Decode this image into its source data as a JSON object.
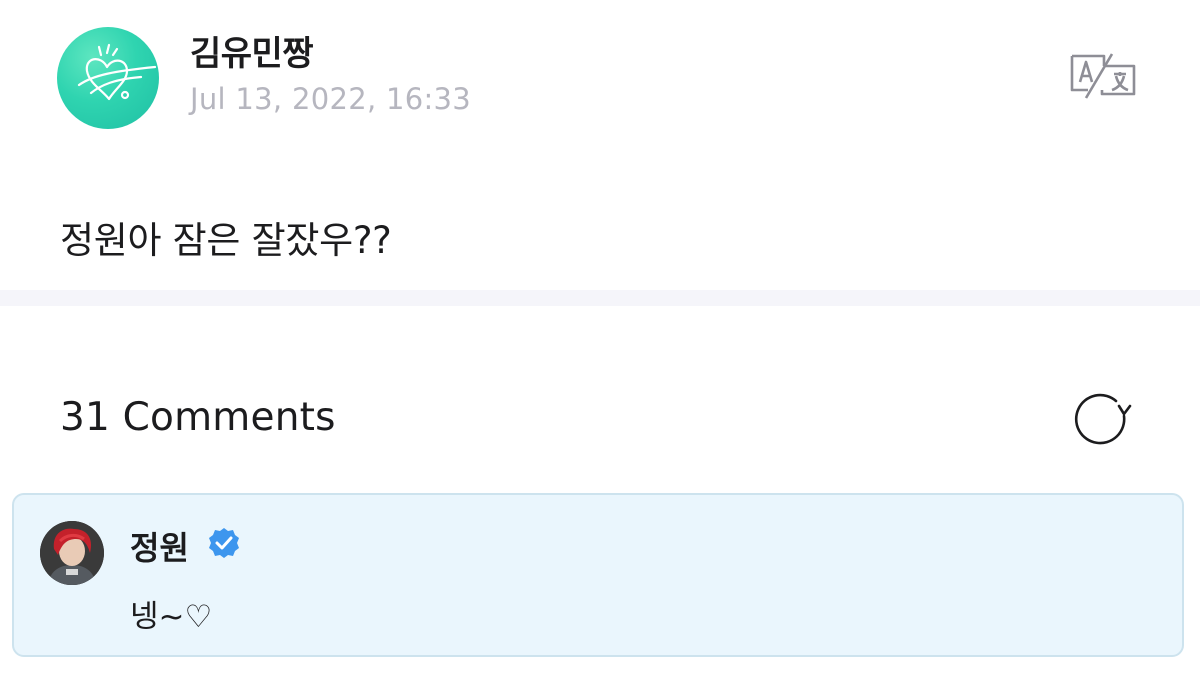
{
  "post": {
    "author_name": "김유민짱",
    "timestamp": "Jul 13, 2022, 16:33",
    "body": "정원아 잠은 잘잤우??",
    "avatar_icon": "signature-heart-avatar",
    "translate_icon": "translate-icon"
  },
  "comments": {
    "header": "31 Comments",
    "refresh_icon": "refresh-icon",
    "items": [
      {
        "author": "정원",
        "verified": true,
        "text": "넹~♡",
        "avatar_icon": "user-photo-avatar"
      }
    ]
  },
  "colors": {
    "avatar_teal": "#2fd4b0",
    "timestamp_gray": "#b6b6bf",
    "divider": "#f5f5fa",
    "comment_bg": "#eaf6fd",
    "comment_border": "#cde3ee",
    "verified_blue": "#3d96ee"
  }
}
